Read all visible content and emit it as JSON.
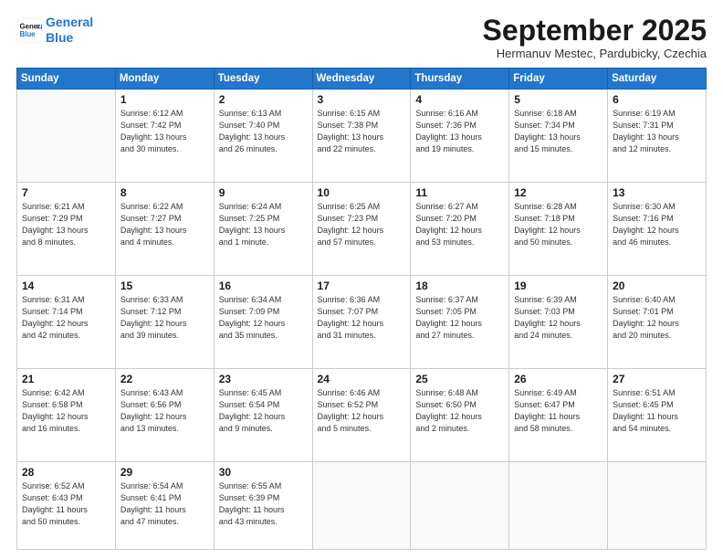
{
  "logo": {
    "line1": "General",
    "line2": "Blue"
  },
  "title": "September 2025",
  "subtitle": "Hermanuv Mestec, Pardubicky, Czechia",
  "weekdays": [
    "Sunday",
    "Monday",
    "Tuesday",
    "Wednesday",
    "Thursday",
    "Friday",
    "Saturday"
  ],
  "weeks": [
    [
      {
        "day": "",
        "detail": ""
      },
      {
        "day": "1",
        "detail": "Sunrise: 6:12 AM\nSunset: 7:42 PM\nDaylight: 13 hours\nand 30 minutes."
      },
      {
        "day": "2",
        "detail": "Sunrise: 6:13 AM\nSunset: 7:40 PM\nDaylight: 13 hours\nand 26 minutes."
      },
      {
        "day": "3",
        "detail": "Sunrise: 6:15 AM\nSunset: 7:38 PM\nDaylight: 13 hours\nand 22 minutes."
      },
      {
        "day": "4",
        "detail": "Sunrise: 6:16 AM\nSunset: 7:36 PM\nDaylight: 13 hours\nand 19 minutes."
      },
      {
        "day": "5",
        "detail": "Sunrise: 6:18 AM\nSunset: 7:34 PM\nDaylight: 13 hours\nand 15 minutes."
      },
      {
        "day": "6",
        "detail": "Sunrise: 6:19 AM\nSunset: 7:31 PM\nDaylight: 13 hours\nand 12 minutes."
      }
    ],
    [
      {
        "day": "7",
        "detail": "Sunrise: 6:21 AM\nSunset: 7:29 PM\nDaylight: 13 hours\nand 8 minutes."
      },
      {
        "day": "8",
        "detail": "Sunrise: 6:22 AM\nSunset: 7:27 PM\nDaylight: 13 hours\nand 4 minutes."
      },
      {
        "day": "9",
        "detail": "Sunrise: 6:24 AM\nSunset: 7:25 PM\nDaylight: 13 hours\nand 1 minute."
      },
      {
        "day": "10",
        "detail": "Sunrise: 6:25 AM\nSunset: 7:23 PM\nDaylight: 12 hours\nand 57 minutes."
      },
      {
        "day": "11",
        "detail": "Sunrise: 6:27 AM\nSunset: 7:20 PM\nDaylight: 12 hours\nand 53 minutes."
      },
      {
        "day": "12",
        "detail": "Sunrise: 6:28 AM\nSunset: 7:18 PM\nDaylight: 12 hours\nand 50 minutes."
      },
      {
        "day": "13",
        "detail": "Sunrise: 6:30 AM\nSunset: 7:16 PM\nDaylight: 12 hours\nand 46 minutes."
      }
    ],
    [
      {
        "day": "14",
        "detail": "Sunrise: 6:31 AM\nSunset: 7:14 PM\nDaylight: 12 hours\nand 42 minutes."
      },
      {
        "day": "15",
        "detail": "Sunrise: 6:33 AM\nSunset: 7:12 PM\nDaylight: 12 hours\nand 39 minutes."
      },
      {
        "day": "16",
        "detail": "Sunrise: 6:34 AM\nSunset: 7:09 PM\nDaylight: 12 hours\nand 35 minutes."
      },
      {
        "day": "17",
        "detail": "Sunrise: 6:36 AM\nSunset: 7:07 PM\nDaylight: 12 hours\nand 31 minutes."
      },
      {
        "day": "18",
        "detail": "Sunrise: 6:37 AM\nSunset: 7:05 PM\nDaylight: 12 hours\nand 27 minutes."
      },
      {
        "day": "19",
        "detail": "Sunrise: 6:39 AM\nSunset: 7:03 PM\nDaylight: 12 hours\nand 24 minutes."
      },
      {
        "day": "20",
        "detail": "Sunrise: 6:40 AM\nSunset: 7:01 PM\nDaylight: 12 hours\nand 20 minutes."
      }
    ],
    [
      {
        "day": "21",
        "detail": "Sunrise: 6:42 AM\nSunset: 6:58 PM\nDaylight: 12 hours\nand 16 minutes."
      },
      {
        "day": "22",
        "detail": "Sunrise: 6:43 AM\nSunset: 6:56 PM\nDaylight: 12 hours\nand 13 minutes."
      },
      {
        "day": "23",
        "detail": "Sunrise: 6:45 AM\nSunset: 6:54 PM\nDaylight: 12 hours\nand 9 minutes."
      },
      {
        "day": "24",
        "detail": "Sunrise: 6:46 AM\nSunset: 6:52 PM\nDaylight: 12 hours\nand 5 minutes."
      },
      {
        "day": "25",
        "detail": "Sunrise: 6:48 AM\nSunset: 6:50 PM\nDaylight: 12 hours\nand 2 minutes."
      },
      {
        "day": "26",
        "detail": "Sunrise: 6:49 AM\nSunset: 6:47 PM\nDaylight: 11 hours\nand 58 minutes."
      },
      {
        "day": "27",
        "detail": "Sunrise: 6:51 AM\nSunset: 6:45 PM\nDaylight: 11 hours\nand 54 minutes."
      }
    ],
    [
      {
        "day": "28",
        "detail": "Sunrise: 6:52 AM\nSunset: 6:43 PM\nDaylight: 11 hours\nand 50 minutes."
      },
      {
        "day": "29",
        "detail": "Sunrise: 6:54 AM\nSunset: 6:41 PM\nDaylight: 11 hours\nand 47 minutes."
      },
      {
        "day": "30",
        "detail": "Sunrise: 6:55 AM\nSunset: 6:39 PM\nDaylight: 11 hours\nand 43 minutes."
      },
      {
        "day": "",
        "detail": ""
      },
      {
        "day": "",
        "detail": ""
      },
      {
        "day": "",
        "detail": ""
      },
      {
        "day": "",
        "detail": ""
      }
    ]
  ]
}
